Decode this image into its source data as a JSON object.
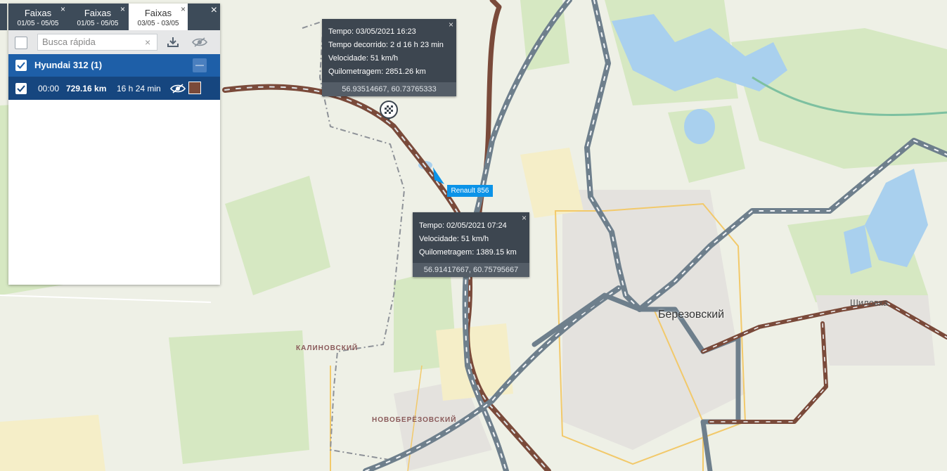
{
  "panel": {
    "tabs": [
      {
        "label": "Faixas",
        "date": "01/05 - 05/05",
        "active": false
      },
      {
        "label": "Faixas",
        "date": "01/05 - 05/05",
        "active": false
      },
      {
        "label": "Faixas",
        "date": "03/05 - 03/05",
        "active": true
      }
    ],
    "tab_close": "×",
    "close": "×",
    "search_placeholder": "Busca rápida",
    "search_clear": "×",
    "group": {
      "name": "Hyundai 312 (1)",
      "collapse": "—"
    },
    "track": {
      "time": "00:00",
      "distance": "729.16 km",
      "duration": "16 h 24 min",
      "color": "#7a4a3a"
    }
  },
  "popup1": {
    "time": "Tempo: 03/05/2021 16:23",
    "elapsed": "Tempo decorrido: 2 d 16 h 23 min",
    "speed": "Velocidade: 51 km/h",
    "mileage": "Quilometragem: 2851.26 km",
    "coords": "56.93514667, 60.73765333",
    "close": "×"
  },
  "popup2": {
    "time": "Tempo: 02/05/2021 07:24",
    "speed": "Velocidade: 51 km/h",
    "mileage": "Quilometragem: 1389.15 km",
    "coords": "56.91417667, 60.75795667",
    "close": "×"
  },
  "vehicle_label": "Renault 856",
  "map": {
    "city": "Березовский",
    "town1": "КАЛИНОВСКИЙ",
    "town2": "НОВОБЕРЁЗОВСКИЙ",
    "town3": "Шиловка"
  },
  "colors": {
    "tab_bar": "#3d4b59",
    "group_row": "#1e5fa8",
    "track_row": "#16467f",
    "route": "#6e7f8c",
    "route_dark": "#7a4a3a",
    "vehicle": "#0b93e8"
  }
}
